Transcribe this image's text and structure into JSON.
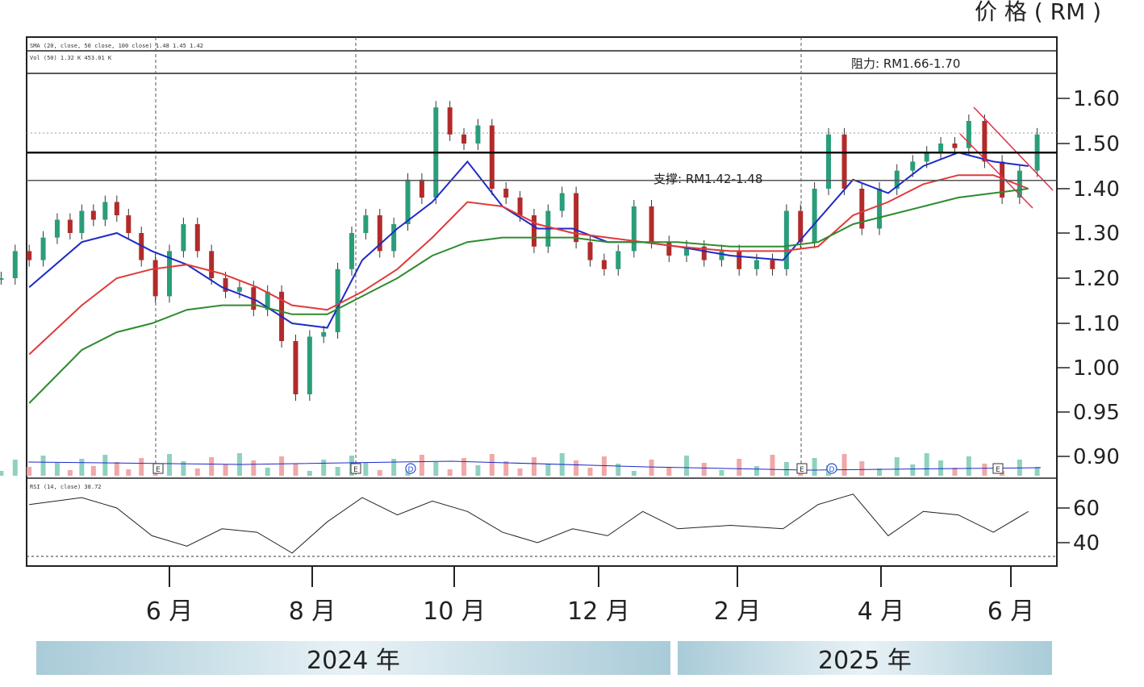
{
  "chart_data": {
    "type": "candlestick",
    "y_unit_label": "价 格 ( RM )",
    "y_ticks": [
      "1.60",
      "1.50",
      "1.40",
      "1.30",
      "1.20",
      "1.10",
      "1.00",
      "0.95",
      "0.90"
    ],
    "y_tick_values": [
      1.6,
      1.5,
      1.4,
      1.3,
      1.2,
      1.1,
      1.0,
      0.95,
      0.9
    ],
    "rsi_ticks": [
      "60",
      "40"
    ],
    "rsi_tick_values": [
      60,
      40
    ],
    "x_month_labels": [
      "6 月",
      "8 月",
      "10 月",
      "12 月",
      "2 月",
      "4 月",
      "6 月"
    ],
    "x_month_dates": [
      "2024-06",
      "2024-08",
      "2024-10",
      "2024-12",
      "2025-02",
      "2025-04",
      "2025-06"
    ],
    "year_labels": [
      "2024 年",
      "2025 年"
    ],
    "resistance_label": "阻力: RM1.66-1.70",
    "support_label": "支撑: RM1.42-1.48",
    "support_range": [
      1.42,
      1.48
    ],
    "resistance_range": [
      1.66,
      1.7
    ],
    "header_lines": [
      "SMA (20, close, 50  close, 100 close)  1.48  1.45  1.42",
      "Vol (50)  1.32 K  453.01 K"
    ],
    "rsi_header": "RSI (14, close)  38.72",
    "event_markers": [
      "E",
      "E",
      "D",
      "E",
      "D",
      "E"
    ],
    "series": [
      {
        "name": "price",
        "color": "#2e2e2e",
        "points": [
          [
            "2024-04",
            1.2
          ],
          [
            "2024-04",
            1.26
          ],
          [
            "2024-04",
            1.24
          ],
          [
            "2024-04",
            1.29
          ],
          [
            "2024-04",
            1.33
          ],
          [
            "2024-05",
            1.3
          ],
          [
            "2024-05",
            1.35
          ],
          [
            "2024-05",
            1.33
          ],
          [
            "2024-05",
            1.37
          ],
          [
            "2024-05",
            1.34
          ],
          [
            "2024-05",
            1.3
          ],
          [
            "2024-06",
            1.24
          ],
          [
            "2024-06",
            1.16
          ],
          [
            "2024-06",
            1.26
          ],
          [
            "2024-06",
            1.32
          ],
          [
            "2024-06",
            1.26
          ],
          [
            "2024-07",
            1.2
          ],
          [
            "2024-07",
            1.17
          ],
          [
            "2024-07",
            1.18
          ],
          [
            "2024-07",
            1.13
          ],
          [
            "2024-07",
            1.17
          ],
          [
            "2024-08",
            1.06
          ],
          [
            "2024-08",
            0.97
          ],
          [
            "2024-08",
            1.07
          ],
          [
            "2024-08",
            1.08
          ],
          [
            "2024-08",
            1.22
          ],
          [
            "2024-09",
            1.3
          ],
          [
            "2024-09",
            1.34
          ],
          [
            "2024-09",
            1.26
          ],
          [
            "2024-09",
            1.32
          ],
          [
            "2024-09",
            1.42
          ],
          [
            "2024-10",
            1.38
          ],
          [
            "2024-10",
            1.58
          ],
          [
            "2024-10",
            1.52
          ],
          [
            "2024-10",
            1.5
          ],
          [
            "2024-10",
            1.54
          ],
          [
            "2024-11",
            1.4
          ],
          [
            "2024-11",
            1.38
          ],
          [
            "2024-11",
            1.34
          ],
          [
            "2024-11",
            1.27
          ],
          [
            "2024-11",
            1.35
          ],
          [
            "2024-12",
            1.39
          ],
          [
            "2024-12",
            1.28
          ],
          [
            "2024-12",
            1.24
          ],
          [
            "2024-12",
            1.22
          ],
          [
            "2024-12",
            1.26
          ],
          [
            "2025-01",
            1.36
          ],
          [
            "2025-01",
            1.28
          ],
          [
            "2025-01",
            1.25
          ],
          [
            "2025-01",
            1.27
          ],
          [
            "2025-02",
            1.24
          ],
          [
            "2025-02",
            1.26
          ],
          [
            "2025-02",
            1.22
          ],
          [
            "2025-02",
            1.24
          ],
          [
            "2025-03",
            1.22
          ],
          [
            "2025-03",
            1.35
          ],
          [
            "2025-03",
            1.28
          ],
          [
            "2025-03",
            1.4
          ],
          [
            "2025-03",
            1.52
          ],
          [
            "2025-04",
            1.4
          ],
          [
            "2025-04",
            1.31
          ],
          [
            "2025-04",
            1.4
          ],
          [
            "2025-04",
            1.44
          ],
          [
            "2025-05",
            1.46
          ],
          [
            "2025-05",
            1.48
          ],
          [
            "2025-05",
            1.5
          ],
          [
            "2025-05",
            1.49
          ],
          [
            "2025-05",
            1.55
          ],
          [
            "2025-06",
            1.46
          ],
          [
            "2025-06",
            1.38
          ],
          [
            "2025-06",
            1.44
          ],
          [
            "2025-06",
            1.52
          ]
        ]
      },
      {
        "name": "SMA 20",
        "color": "#1e2ac8",
        "points": [
          [
            "2024-04",
            1.18
          ],
          [
            "2024-05",
            1.28
          ],
          [
            "2024-05",
            1.3
          ],
          [
            "2024-06",
            1.26
          ],
          [
            "2024-06",
            1.23
          ],
          [
            "2024-07",
            1.18
          ],
          [
            "2024-07",
            1.15
          ],
          [
            "2024-08",
            1.1
          ],
          [
            "2024-08",
            1.09
          ],
          [
            "2024-09",
            1.24
          ],
          [
            "2024-09",
            1.31
          ],
          [
            "2024-10",
            1.37
          ],
          [
            "2024-10",
            1.46
          ],
          [
            "2024-11",
            1.36
          ],
          [
            "2024-11",
            1.31
          ],
          [
            "2024-12",
            1.31
          ],
          [
            "2024-12",
            1.28
          ],
          [
            "2025-01",
            1.28
          ],
          [
            "2025-01",
            1.27
          ],
          [
            "2025-02",
            1.25
          ],
          [
            "2025-03",
            1.24
          ],
          [
            "2025-03",
            1.33
          ],
          [
            "2025-04",
            1.42
          ],
          [
            "2025-04",
            1.39
          ],
          [
            "2025-05",
            1.45
          ],
          [
            "2025-05",
            1.48
          ],
          [
            "2025-06",
            1.46
          ],
          [
            "2025-06",
            1.45
          ]
        ]
      },
      {
        "name": "SMA 50",
        "color": "#e03a3a",
        "points": [
          [
            "2024-04",
            1.03
          ],
          [
            "2024-05",
            1.14
          ],
          [
            "2024-05",
            1.2
          ],
          [
            "2024-06",
            1.22
          ],
          [
            "2024-06",
            1.23
          ],
          [
            "2024-07",
            1.21
          ],
          [
            "2024-07",
            1.18
          ],
          [
            "2024-08",
            1.14
          ],
          [
            "2024-08",
            1.13
          ],
          [
            "2024-09",
            1.17
          ],
          [
            "2024-09",
            1.22
          ],
          [
            "2024-10",
            1.29
          ],
          [
            "2024-10",
            1.37
          ],
          [
            "2024-11",
            1.36
          ],
          [
            "2024-11",
            1.32
          ],
          [
            "2024-12",
            1.3
          ],
          [
            "2024-12",
            1.29
          ],
          [
            "2025-01",
            1.28
          ],
          [
            "2025-01",
            1.27
          ],
          [
            "2025-02",
            1.26
          ],
          [
            "2025-03",
            1.26
          ],
          [
            "2025-03",
            1.27
          ],
          [
            "2025-04",
            1.34
          ],
          [
            "2025-04",
            1.37
          ],
          [
            "2025-05",
            1.41
          ],
          [
            "2025-05",
            1.43
          ],
          [
            "2025-06",
            1.43
          ],
          [
            "2025-06",
            1.4
          ]
        ]
      },
      {
        "name": "SMA 100",
        "color": "#2e8b2e",
        "points": [
          [
            "2024-04",
            0.96
          ],
          [
            "2024-05",
            1.04
          ],
          [
            "2024-05",
            1.08
          ],
          [
            "2024-06",
            1.1
          ],
          [
            "2024-06",
            1.13
          ],
          [
            "2024-07",
            1.14
          ],
          [
            "2024-07",
            1.14
          ],
          [
            "2024-08",
            1.12
          ],
          [
            "2024-08",
            1.12
          ],
          [
            "2024-09",
            1.16
          ],
          [
            "2024-09",
            1.2
          ],
          [
            "2024-10",
            1.25
          ],
          [
            "2024-10",
            1.28
          ],
          [
            "2024-11",
            1.29
          ],
          [
            "2024-11",
            1.29
          ],
          [
            "2024-12",
            1.29
          ],
          [
            "2024-12",
            1.28
          ],
          [
            "2025-01",
            1.28
          ],
          [
            "2025-01",
            1.28
          ],
          [
            "2025-02",
            1.27
          ],
          [
            "2025-03",
            1.27
          ],
          [
            "2025-03",
            1.28
          ],
          [
            "2025-04",
            1.32
          ],
          [
            "2025-04",
            1.34
          ],
          [
            "2025-05",
            1.36
          ],
          [
            "2025-05",
            1.38
          ],
          [
            "2025-06",
            1.39
          ],
          [
            "2025-06",
            1.4
          ]
        ]
      },
      {
        "name": "RSI 14",
        "color": "#222222",
        "points": [
          [
            "2024-04",
            62
          ],
          [
            "2024-05",
            66
          ],
          [
            "2024-05",
            60
          ],
          [
            "2024-06",
            44
          ],
          [
            "2024-06",
            38
          ],
          [
            "2024-07",
            48
          ],
          [
            "2024-07",
            46
          ],
          [
            "2024-08",
            34
          ],
          [
            "2024-08",
            52
          ],
          [
            "2024-09",
            66
          ],
          [
            "2024-09",
            56
          ],
          [
            "2024-10",
            64
          ],
          [
            "2024-10",
            58
          ],
          [
            "2024-11",
            46
          ],
          [
            "2024-11",
            40
          ],
          [
            "2024-12",
            48
          ],
          [
            "2024-12",
            44
          ],
          [
            "2025-01",
            58
          ],
          [
            "2025-01",
            48
          ],
          [
            "2025-02",
            50
          ],
          [
            "2025-03",
            48
          ],
          [
            "2025-03",
            62
          ],
          [
            "2025-04",
            68
          ],
          [
            "2025-04",
            44
          ],
          [
            "2025-05",
            58
          ],
          [
            "2025-05",
            56
          ],
          [
            "2025-06",
            46
          ],
          [
            "2025-06",
            58
          ]
        ]
      }
    ]
  }
}
